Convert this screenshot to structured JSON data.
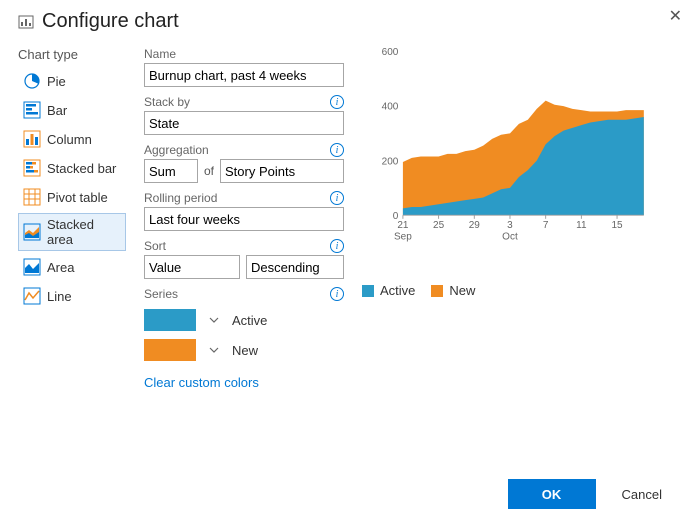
{
  "dialog": {
    "title": "Configure chart",
    "close_label": "Close"
  },
  "chart_type": {
    "section_label": "Chart type",
    "items": [
      {
        "label": "Pie",
        "icon": "pie-icon"
      },
      {
        "label": "Bar",
        "icon": "bar-icon"
      },
      {
        "label": "Column",
        "icon": "column-icon"
      },
      {
        "label": "Stacked bar",
        "icon": "stacked-bar-icon"
      },
      {
        "label": "Pivot table",
        "icon": "pivot-table-icon"
      },
      {
        "label": "Stacked area",
        "icon": "stacked-area-icon"
      },
      {
        "label": "Area",
        "icon": "area-icon"
      },
      {
        "label": "Line",
        "icon": "line-icon"
      }
    ],
    "selected_index": 5
  },
  "form": {
    "name_label": "Name",
    "name_value": "Burnup chart, past 4 weeks",
    "stackby_label": "Stack by",
    "stackby_value": "State",
    "aggregation_label": "Aggregation",
    "aggregation_value": "Sum",
    "aggregation_of_label": "of",
    "aggregation_field_value": "Story Points",
    "rolling_label": "Rolling period",
    "rolling_value": "Last four weeks",
    "sort_label": "Sort",
    "sort_by_value": "Value",
    "sort_dir_value": "Descending",
    "series_label": "Series",
    "series": [
      {
        "color": "#2b9bc7",
        "name": "Active"
      },
      {
        "color": "#f08c22",
        "name": "New"
      }
    ],
    "clear_colors": "Clear custom colors"
  },
  "legend": {
    "items": [
      {
        "color": "#2b9bc7",
        "label": "Active"
      },
      {
        "color": "#f08c22",
        "label": "New"
      }
    ]
  },
  "buttons": {
    "ok": "OK",
    "cancel": "Cancel"
  },
  "colors": {
    "accent": "#0078d4",
    "blue": "#2b9bc7",
    "orange": "#f08c22"
  },
  "chart_data": {
    "type": "area",
    "title": "",
    "xlabel": "",
    "ylabel": "",
    "ylim": [
      0,
      600
    ],
    "yticks": [
      0,
      200,
      400,
      600
    ],
    "x_categories": [
      "21\nSep",
      "25",
      "29",
      "3\nOct",
      "7",
      "11",
      "15"
    ],
    "x": [
      21,
      22,
      23,
      24,
      25,
      26,
      27,
      28,
      29,
      30,
      1,
      2,
      3,
      4,
      5,
      6,
      7,
      8,
      9,
      10,
      11,
      12,
      13,
      14,
      15,
      16,
      17,
      18
    ],
    "series": [
      {
        "name": "Active",
        "color": "#2b9bc7",
        "values": [
          25,
          30,
          30,
          35,
          40,
          45,
          50,
          55,
          60,
          65,
          80,
          95,
          100,
          140,
          165,
          200,
          260,
          290,
          310,
          320,
          330,
          340,
          345,
          350,
          350,
          350,
          355,
          360
        ]
      },
      {
        "name": "New",
        "color": "#f08c22",
        "values": [
          195,
          210,
          215,
          215,
          215,
          225,
          225,
          235,
          240,
          255,
          280,
          295,
          300,
          335,
          350,
          390,
          420,
          405,
          400,
          390,
          385,
          380,
          380,
          380,
          380,
          385,
          385,
          385
        ]
      }
    ]
  }
}
